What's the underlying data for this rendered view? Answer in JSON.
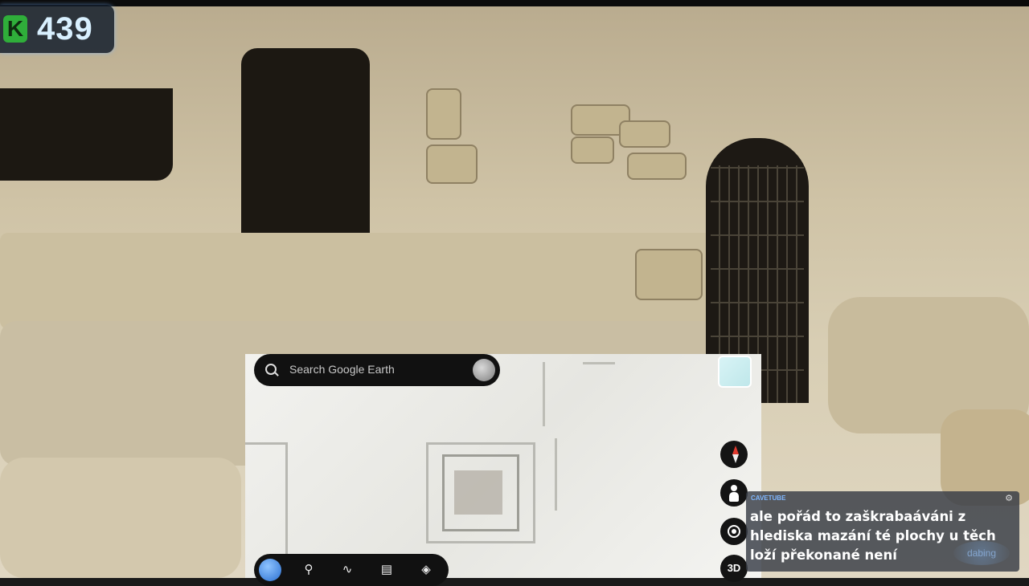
{
  "colors": {
    "badge_bg": "#141e2d",
    "badge_k": "#2fae3a",
    "caption_bg": "#373c46",
    "map_bg": "#f0f0ed",
    "toolbar_bg": "#111111"
  },
  "badge": {
    "letter": "K",
    "count": "439"
  },
  "google_earth": {
    "search_placeholder": "Search Google Earth",
    "controls": {
      "compass_icon": "compass-icon",
      "pegman_icon": "pegman-icon",
      "locate_icon": "locate-icon",
      "mode_3d": "3D"
    },
    "toolbar": [
      {
        "icon": "earth-globe-icon"
      },
      {
        "icon": "placemark-pin-icon"
      },
      {
        "icon": "path-icon"
      },
      {
        "icon": "ruler-icon"
      },
      {
        "icon": "layers-icon"
      }
    ]
  },
  "caption": {
    "source": "CAVETUBE",
    "text": "ale pořád to zaškrabaáváni z hlediska mazání té plochy u těch loží překonané není",
    "watermark": "dabing"
  }
}
